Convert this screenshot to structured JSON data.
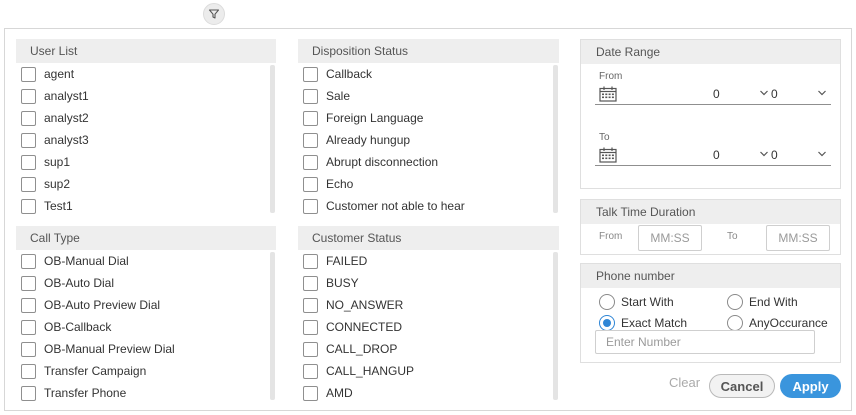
{
  "user_list": {
    "title": "User List",
    "items": [
      "agent",
      "analyst1",
      "analyst2",
      "analyst3",
      "sup1",
      "sup2",
      "Test1"
    ]
  },
  "disposition_status": {
    "title": "Disposition Status",
    "items": [
      "Callback",
      "Sale",
      "Foreign Language",
      "Already hungup",
      "Abrupt disconnection",
      "Echo",
      "Customer not able to hear"
    ]
  },
  "call_type": {
    "title": "Call Type",
    "items": [
      "OB-Manual Dial",
      "OB-Auto Dial",
      "OB-Auto Preview Dial",
      "OB-Callback",
      "OB-Manual Preview Dial",
      "Transfer Campaign",
      "Transfer Phone"
    ]
  },
  "customer_status": {
    "title": "Customer Status",
    "items": [
      "FAILED",
      "BUSY",
      "NO_ANSWER",
      "CONNECTED",
      "CALL_DROP",
      "CALL_HANGUP",
      "AMD"
    ]
  },
  "date_range": {
    "title": "Date Range",
    "from_label": "From",
    "to_label": "To",
    "from_hour": "0",
    "from_minute": "0",
    "to_hour": "0",
    "to_minute": "0"
  },
  "talk_time": {
    "title": "Talk Time Duration",
    "from_label": "From",
    "to_label": "To",
    "from_placeholder": "MM:SS",
    "to_placeholder": "MM:SS"
  },
  "phone_number": {
    "title": "Phone number",
    "options": [
      "Start With",
      "End With",
      "Exact Match",
      "AnyOccurance"
    ],
    "selected": "Exact Match",
    "placeholder": "Enter Number"
  },
  "actions": {
    "clear": "Clear",
    "cancel": "Cancel",
    "apply": "Apply"
  },
  "colors": {
    "accent": "#3a95dd",
    "header_bg": "#eeeeee"
  }
}
